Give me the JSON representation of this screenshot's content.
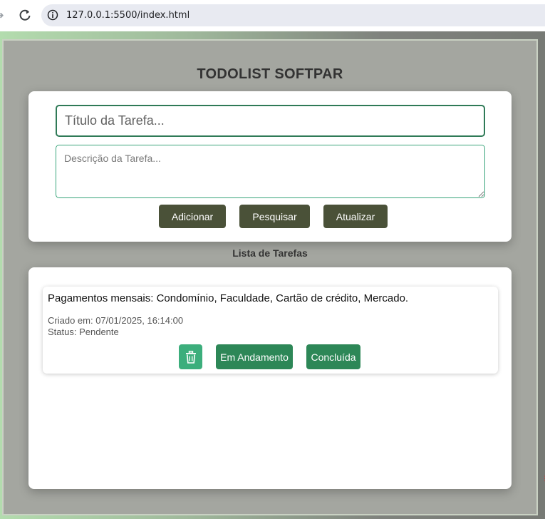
{
  "browser": {
    "url": "127.0.0.1:5500/index.html",
    "nav_icons": [
      "forward-icon",
      "reload-icon",
      "info-icon"
    ]
  },
  "app": {
    "title": "TODOLIST SOFTPAR"
  },
  "form": {
    "title_placeholder": "Título da Tarefa...",
    "title_value": "",
    "description_placeholder": "Descrição da Tarefa...",
    "description_value": "",
    "buttons": {
      "add": "Adicionar",
      "search": "Pesquisar",
      "update": "Atualizar"
    }
  },
  "list": {
    "heading": "Lista de Tarefas",
    "tasks": [
      {
        "title": "Pagamentos mensais: Condomínio, Faculdade, Cartão de crédito, Mercado.",
        "created": "Criado em: 07/01/2025, 16:14:00",
        "status": "Status: Pendente",
        "actions": {
          "delete_icon": "trash-icon",
          "in_progress": "Em Andamento",
          "done": "Concluída"
        }
      }
    ]
  },
  "colors": {
    "primary_dark": "#4a5138",
    "accent_green": "#2d8757",
    "delete_green": "#3cae7c",
    "input_border": "#2f7a57"
  }
}
